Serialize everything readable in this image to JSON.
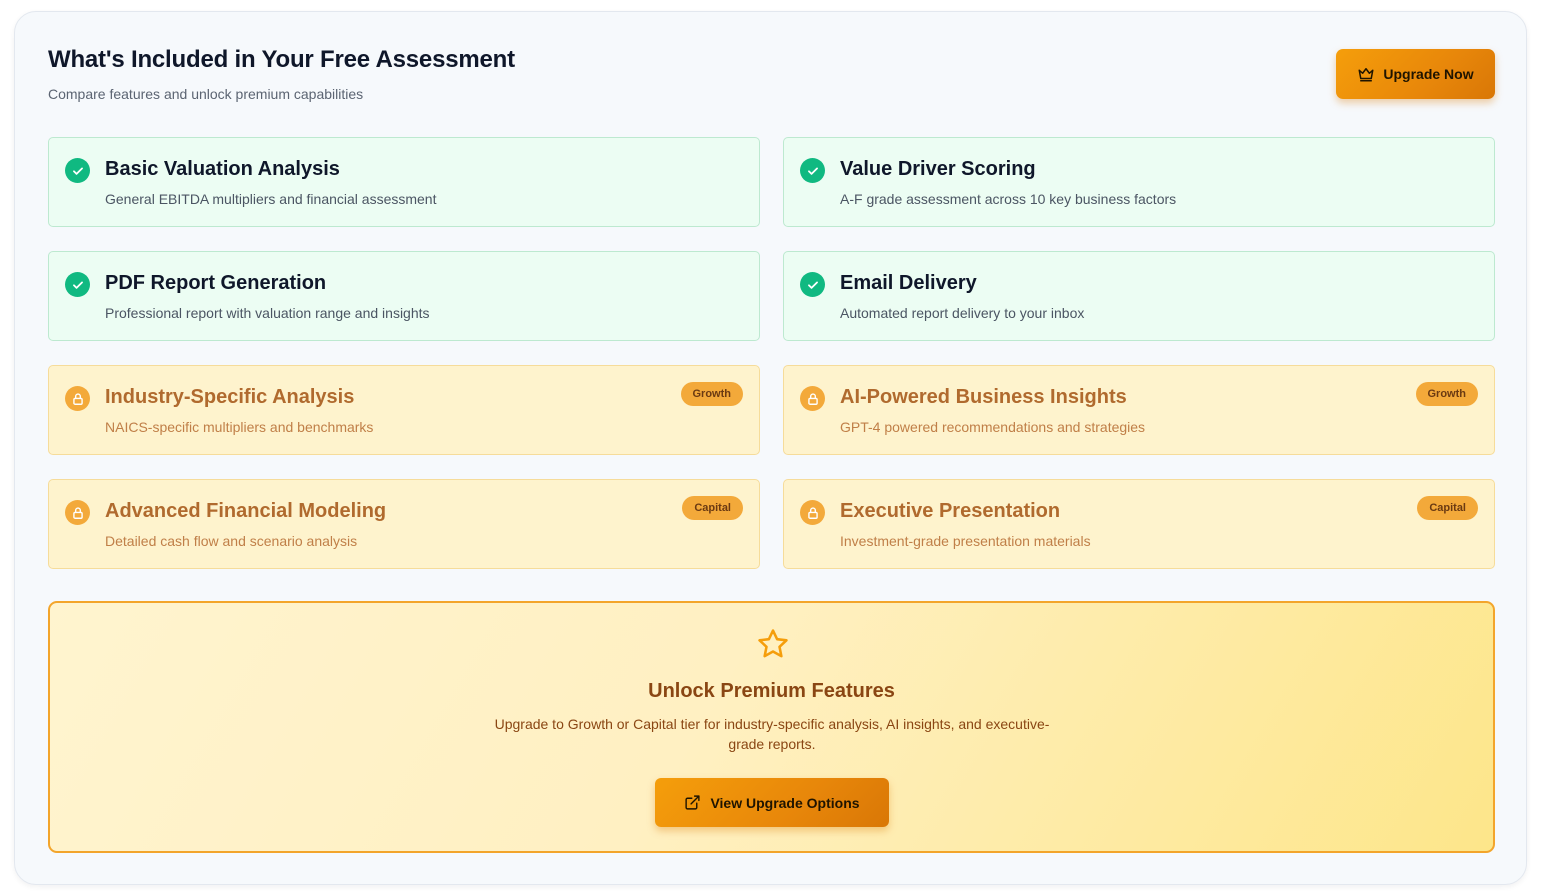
{
  "header": {
    "title": "What's Included in Your Free Assessment",
    "subtitle": "Compare features and unlock premium capabilities",
    "upgrade_button": "Upgrade Now",
    "upgrade_icon": "crown-icon"
  },
  "features": [
    {
      "title": "Basic Valuation Analysis",
      "description": "General EBITDA multipliers and financial assessment",
      "status": "included",
      "icon": "check-circle-icon"
    },
    {
      "title": "Value Driver Scoring",
      "description": "A-F grade assessment across 10 key business factors",
      "status": "included",
      "icon": "check-circle-icon"
    },
    {
      "title": "PDF Report Generation",
      "description": "Professional report with valuation range and insights",
      "status": "included",
      "icon": "check-circle-icon"
    },
    {
      "title": "Email Delivery",
      "description": "Automated report delivery to your inbox",
      "status": "included",
      "icon": "check-circle-icon"
    },
    {
      "title": "Industry-Specific Analysis",
      "description": "NAICS-specific multipliers and benchmarks",
      "status": "locked",
      "badge": "Growth",
      "icon": "lock-icon"
    },
    {
      "title": "AI-Powered Business Insights",
      "description": "GPT-4 powered recommendations and strategies",
      "status": "locked",
      "badge": "Growth",
      "icon": "lock-icon"
    },
    {
      "title": "Advanced Financial Modeling",
      "description": "Detailed cash flow and scenario analysis",
      "status": "locked",
      "badge": "Capital",
      "icon": "lock-icon"
    },
    {
      "title": "Executive Presentation",
      "description": "Investment-grade presentation materials",
      "status": "locked",
      "badge": "Capital",
      "icon": "lock-icon"
    }
  ],
  "promo": {
    "icon": "star-icon",
    "title": "Unlock Premium Features",
    "description": "Upgrade to Growth or Capital tier for industry-specific analysis, AI insights, and executive-grade reports.",
    "button": "View Upgrade Options",
    "button_icon": "external-link-icon"
  },
  "colors": {
    "included_accent": "#10b981",
    "locked_accent": "#f3a93a",
    "primary_button": "#f59e0b"
  }
}
